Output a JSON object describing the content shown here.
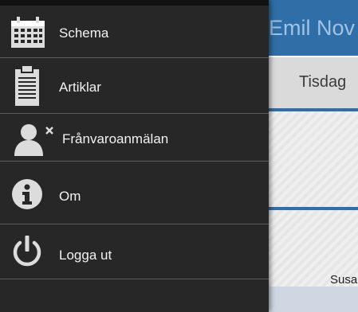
{
  "app": {
    "title": "Emil Nov",
    "day_label": "Tisdag",
    "visible_name": "Susa"
  },
  "drawer": {
    "items": [
      {
        "label": "Schema",
        "icon": "calendar-icon"
      },
      {
        "label": "Artiklar",
        "icon": "clipboard-icon"
      },
      {
        "label": "Frånvaroanmälan",
        "icon": "user-remove-icon"
      },
      {
        "label": "Om",
        "icon": "info-icon"
      },
      {
        "label": "Logga ut",
        "icon": "power-icon"
      }
    ]
  },
  "colors": {
    "drawer_bg": "#272727",
    "header_blue": "#2f6ea6",
    "icon": "#dcdcdc"
  }
}
